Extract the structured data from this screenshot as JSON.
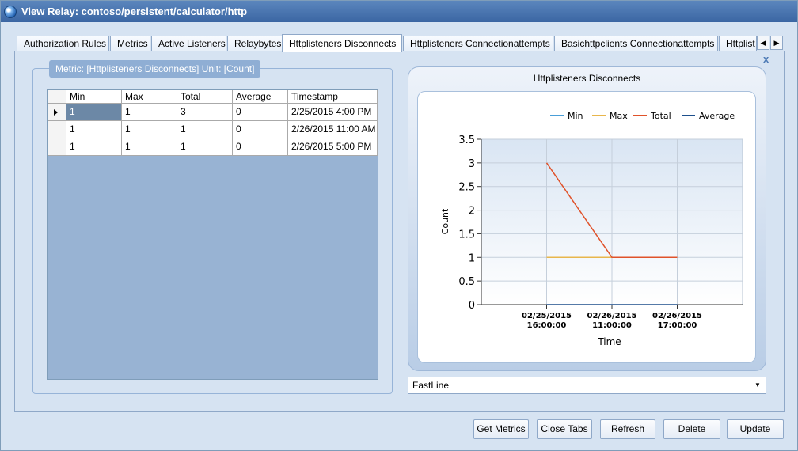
{
  "window": {
    "title": "View Relay: contoso/persistent/calculator/http"
  },
  "tabs": [
    {
      "label": "Authorization Rules"
    },
    {
      "label": "Metrics"
    },
    {
      "label": "Active Listeners"
    },
    {
      "label": "Relaybytes"
    },
    {
      "label": "Httplisteners Disconnects"
    },
    {
      "label": "Httplisteners Connectionattempts"
    },
    {
      "label": "Basichttpclients Connectionattempts"
    },
    {
      "label": "Httplist"
    }
  ],
  "tab_scroll": {
    "left": "◀",
    "right": "▶"
  },
  "close_tab_glyph": "x",
  "metric_group": {
    "label": "Metric: [Httplisteners Disconnects] Unit: [Count]"
  },
  "grid": {
    "columns": [
      "Min",
      "Max",
      "Total",
      "Average",
      "Timestamp"
    ],
    "rows": [
      [
        "1",
        "1",
        "3",
        "0",
        "2/25/2015 4:00 PM"
      ],
      [
        "1",
        "1",
        "1",
        "0",
        "2/26/2015 11:00 AM"
      ],
      [
        "1",
        "1",
        "1",
        "0",
        "2/26/2015 5:00 PM"
      ]
    ]
  },
  "chart_data": {
    "type": "line",
    "title": "Httplisteners Disconnects",
    "xlabel": "Time",
    "ylabel": "Count",
    "x": [
      "02/25/2015 16:00:00",
      "02/26/2015 11:00:00",
      "02/26/2015 17:00:00"
    ],
    "ylim": [
      0,
      3.5
    ],
    "yticks": [
      "3.5",
      "3",
      "2.5",
      "2",
      "1.5",
      "1",
      "0.5",
      "0"
    ],
    "grid": true,
    "legend_position": "top-right",
    "series": [
      {
        "name": "Min",
        "values": [
          1,
          1,
          1
        ],
        "color": "#4a9fd8"
      },
      {
        "name": "Max",
        "values": [
          1,
          1,
          1
        ],
        "color": "#e8b64c"
      },
      {
        "name": "Total",
        "values": [
          3,
          1,
          1
        ],
        "color": "#e0522a"
      },
      {
        "name": "Average",
        "values": [
          0,
          0,
          0
        ],
        "color": "#1d4f8c"
      }
    ]
  },
  "chart_type_select": {
    "value": "FastLine",
    "arrow": "▼"
  },
  "buttons": {
    "get_metrics": "Get Metrics",
    "close_tabs": "Close Tabs",
    "refresh": "Refresh",
    "delete": "Delete",
    "update": "Update"
  }
}
